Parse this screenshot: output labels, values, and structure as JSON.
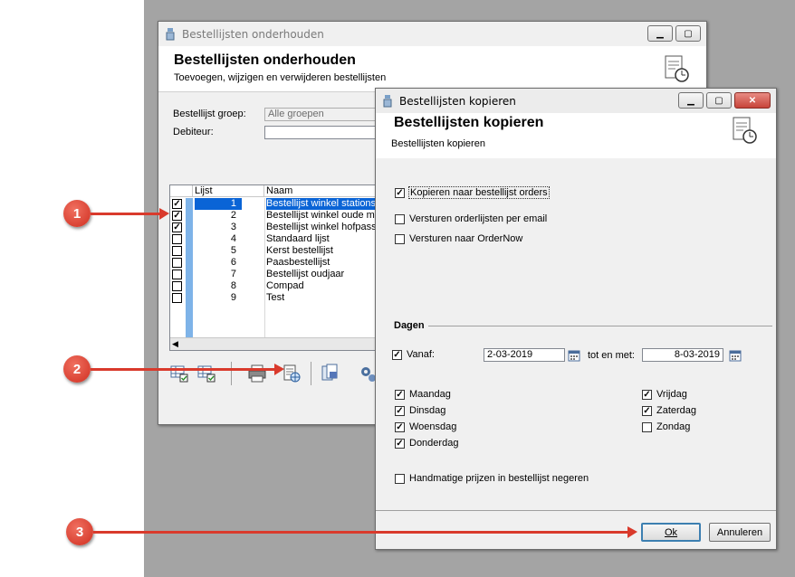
{
  "main_window": {
    "title": "Bestellijsten onderhouden",
    "header_title": "Bestellijsten onderhouden",
    "header_subtitle": "Toevoegen, wijzigen en verwijderen bestellijsten",
    "group_label": "Bestellijst groep:",
    "group_value": "Alle groepen",
    "debtor_label": "Debiteur:",
    "debtor_value": "",
    "grid": {
      "col_list": "Lijst",
      "col_name": "Naam",
      "rows": [
        {
          "num": "1",
          "name": "Bestellijst winkel stations",
          "checked": true,
          "selected": true
        },
        {
          "num": "2",
          "name": "Bestellijst winkel oude ma",
          "checked": true,
          "selected": false
        },
        {
          "num": "3",
          "name": "Bestellijst winkel hofpassa",
          "checked": true,
          "selected": false
        },
        {
          "num": "4",
          "name": "Standaard lijst",
          "checked": false,
          "selected": false
        },
        {
          "num": "5",
          "name": "Kerst bestellijst",
          "checked": false,
          "selected": false
        },
        {
          "num": "6",
          "name": "Paasbestellijst",
          "checked": false,
          "selected": false
        },
        {
          "num": "7",
          "name": "Bestellijst oudjaar",
          "checked": false,
          "selected": false
        },
        {
          "num": "8",
          "name": "Compad",
          "checked": false,
          "selected": false
        },
        {
          "num": "9",
          "name": "Test",
          "checked": false,
          "selected": false
        }
      ]
    },
    "toolbar_icons": [
      "select-all-icon",
      "deselect-all-icon",
      "print-icon",
      "copy-lists-icon",
      "document-copy-icon",
      "settings-gear-icon"
    ]
  },
  "dialog": {
    "title": "Bestellijsten kopieren",
    "header_title": "Bestellijsten kopieren",
    "header_subtitle": "Bestellijsten kopieren",
    "options": [
      {
        "label": "Kopieren naar bestellijst orders",
        "checked": true
      },
      {
        "label": "Versturen orderlijsten per email",
        "checked": false
      },
      {
        "label": "Versturen naar OrderNow",
        "checked": false
      }
    ],
    "days_section": "Dagen",
    "from_label": "Vanaf:",
    "from_checked": true,
    "from_date": "2-03-2019",
    "until_label": "tot en met:",
    "until_date": "8-03-2019",
    "days_left": [
      {
        "label": "Maandag",
        "checked": true
      },
      {
        "label": "Dinsdag",
        "checked": true
      },
      {
        "label": "Woensdag",
        "checked": true
      },
      {
        "label": "Donderdag",
        "checked": true
      }
    ],
    "days_right": [
      {
        "label": "Vrijdag",
        "checked": true
      },
      {
        "label": "Zaterdag",
        "checked": true
      },
      {
        "label": "Zondag",
        "checked": false
      }
    ],
    "ignore_prices_label": "Handmatige prijzen in bestellijst negeren",
    "ignore_prices_checked": false,
    "ok_label": "Ok",
    "cancel_label": "Annuleren"
  },
  "callouts": [
    "1",
    "2",
    "3"
  ],
  "colors": {
    "callout": "#d93a2c",
    "selection": "#0a64d6",
    "background": "#a4a4a4"
  }
}
